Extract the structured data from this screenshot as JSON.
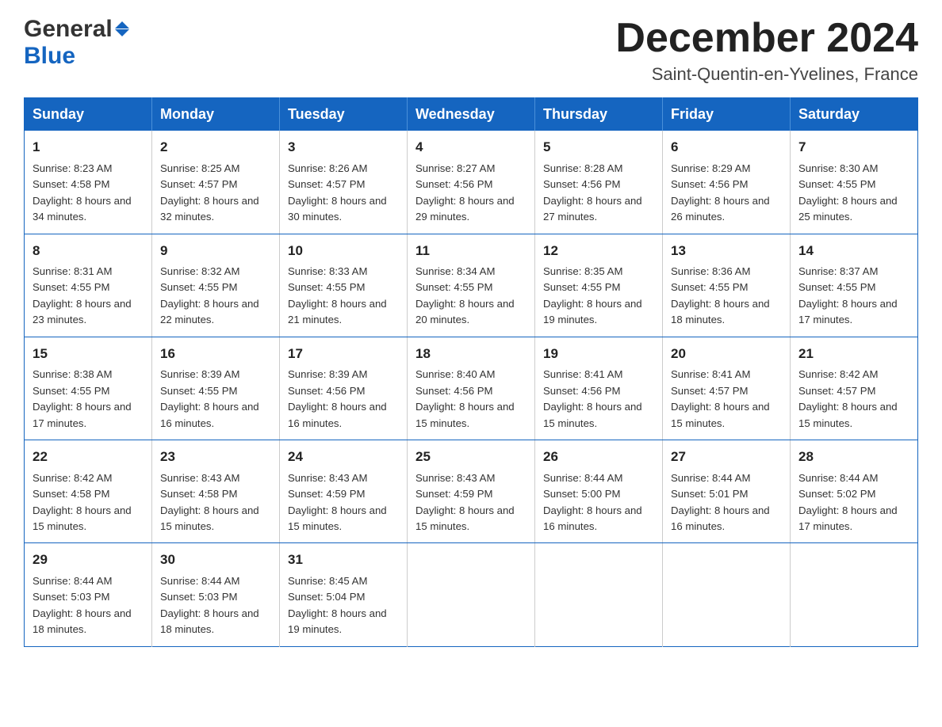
{
  "header": {
    "logo_general": "General",
    "logo_blue": "Blue",
    "month_title": "December 2024",
    "subtitle": "Saint-Quentin-en-Yvelines, France"
  },
  "calendar": {
    "days_of_week": [
      "Sunday",
      "Monday",
      "Tuesday",
      "Wednesday",
      "Thursday",
      "Friday",
      "Saturday"
    ],
    "weeks": [
      [
        {
          "day": "1",
          "sunrise": "8:23 AM",
          "sunset": "4:58 PM",
          "daylight": "8 hours and 34 minutes."
        },
        {
          "day": "2",
          "sunrise": "8:25 AM",
          "sunset": "4:57 PM",
          "daylight": "8 hours and 32 minutes."
        },
        {
          "day": "3",
          "sunrise": "8:26 AM",
          "sunset": "4:57 PM",
          "daylight": "8 hours and 30 minutes."
        },
        {
          "day": "4",
          "sunrise": "8:27 AM",
          "sunset": "4:56 PM",
          "daylight": "8 hours and 29 minutes."
        },
        {
          "day": "5",
          "sunrise": "8:28 AM",
          "sunset": "4:56 PM",
          "daylight": "8 hours and 27 minutes."
        },
        {
          "day": "6",
          "sunrise": "8:29 AM",
          "sunset": "4:56 PM",
          "daylight": "8 hours and 26 minutes."
        },
        {
          "day": "7",
          "sunrise": "8:30 AM",
          "sunset": "4:55 PM",
          "daylight": "8 hours and 25 minutes."
        }
      ],
      [
        {
          "day": "8",
          "sunrise": "8:31 AM",
          "sunset": "4:55 PM",
          "daylight": "8 hours and 23 minutes."
        },
        {
          "day": "9",
          "sunrise": "8:32 AM",
          "sunset": "4:55 PM",
          "daylight": "8 hours and 22 minutes."
        },
        {
          "day": "10",
          "sunrise": "8:33 AM",
          "sunset": "4:55 PM",
          "daylight": "8 hours and 21 minutes."
        },
        {
          "day": "11",
          "sunrise": "8:34 AM",
          "sunset": "4:55 PM",
          "daylight": "8 hours and 20 minutes."
        },
        {
          "day": "12",
          "sunrise": "8:35 AM",
          "sunset": "4:55 PM",
          "daylight": "8 hours and 19 minutes."
        },
        {
          "day": "13",
          "sunrise": "8:36 AM",
          "sunset": "4:55 PM",
          "daylight": "8 hours and 18 minutes."
        },
        {
          "day": "14",
          "sunrise": "8:37 AM",
          "sunset": "4:55 PM",
          "daylight": "8 hours and 17 minutes."
        }
      ],
      [
        {
          "day": "15",
          "sunrise": "8:38 AM",
          "sunset": "4:55 PM",
          "daylight": "8 hours and 17 minutes."
        },
        {
          "day": "16",
          "sunrise": "8:39 AM",
          "sunset": "4:55 PM",
          "daylight": "8 hours and 16 minutes."
        },
        {
          "day": "17",
          "sunrise": "8:39 AM",
          "sunset": "4:56 PM",
          "daylight": "8 hours and 16 minutes."
        },
        {
          "day": "18",
          "sunrise": "8:40 AM",
          "sunset": "4:56 PM",
          "daylight": "8 hours and 15 minutes."
        },
        {
          "day": "19",
          "sunrise": "8:41 AM",
          "sunset": "4:56 PM",
          "daylight": "8 hours and 15 minutes."
        },
        {
          "day": "20",
          "sunrise": "8:41 AM",
          "sunset": "4:57 PM",
          "daylight": "8 hours and 15 minutes."
        },
        {
          "day": "21",
          "sunrise": "8:42 AM",
          "sunset": "4:57 PM",
          "daylight": "8 hours and 15 minutes."
        }
      ],
      [
        {
          "day": "22",
          "sunrise": "8:42 AM",
          "sunset": "4:58 PM",
          "daylight": "8 hours and 15 minutes."
        },
        {
          "day": "23",
          "sunrise": "8:43 AM",
          "sunset": "4:58 PM",
          "daylight": "8 hours and 15 minutes."
        },
        {
          "day": "24",
          "sunrise": "8:43 AM",
          "sunset": "4:59 PM",
          "daylight": "8 hours and 15 minutes."
        },
        {
          "day": "25",
          "sunrise": "8:43 AM",
          "sunset": "4:59 PM",
          "daylight": "8 hours and 15 minutes."
        },
        {
          "day": "26",
          "sunrise": "8:44 AM",
          "sunset": "5:00 PM",
          "daylight": "8 hours and 16 minutes."
        },
        {
          "day": "27",
          "sunrise": "8:44 AM",
          "sunset": "5:01 PM",
          "daylight": "8 hours and 16 minutes."
        },
        {
          "day": "28",
          "sunrise": "8:44 AM",
          "sunset": "5:02 PM",
          "daylight": "8 hours and 17 minutes."
        }
      ],
      [
        {
          "day": "29",
          "sunrise": "8:44 AM",
          "sunset": "5:03 PM",
          "daylight": "8 hours and 18 minutes."
        },
        {
          "day": "30",
          "sunrise": "8:44 AM",
          "sunset": "5:03 PM",
          "daylight": "8 hours and 18 minutes."
        },
        {
          "day": "31",
          "sunrise": "8:45 AM",
          "sunset": "5:04 PM",
          "daylight": "8 hours and 19 minutes."
        },
        null,
        null,
        null,
        null
      ]
    ]
  }
}
